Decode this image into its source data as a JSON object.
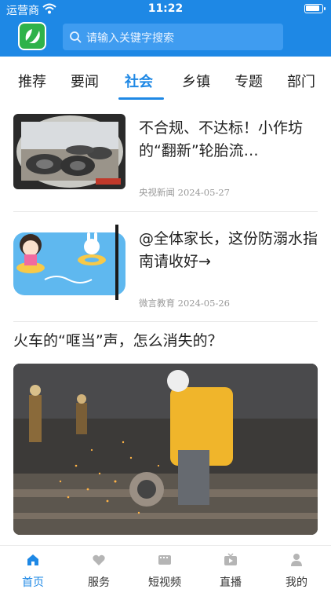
{
  "status_bar": {
    "carrier": "运营商",
    "time": "11:22"
  },
  "header": {
    "search_placeholder": "请输入关键字搜索"
  },
  "tabs": [
    {
      "label": "推荐",
      "active": false
    },
    {
      "label": "要闻",
      "active": false
    },
    {
      "label": "社会",
      "active": true
    },
    {
      "label": "乡镇",
      "active": false
    },
    {
      "label": "专题",
      "active": false
    },
    {
      "label": "部门",
      "active": false
    }
  ],
  "articles": [
    {
      "title": "不合规、不达标！小作坊的“翻新”轮胎流…",
      "source": "央视新闻",
      "date": "2024-05-27"
    },
    {
      "title": "@全体家长，这份防溺水指南请收好→",
      "source": "微言教育",
      "date": "2024-05-26"
    }
  ],
  "featured": {
    "title": "火车的“哐当”声，怎么消失的？"
  },
  "bottom_nav": [
    {
      "label": "首页",
      "icon": "home-icon",
      "active": true
    },
    {
      "label": "服务",
      "icon": "heart-icon",
      "active": false
    },
    {
      "label": "短视频",
      "icon": "film-icon",
      "active": false
    },
    {
      "label": "直播",
      "icon": "tv-icon",
      "active": false
    },
    {
      "label": "我的",
      "icon": "person-icon",
      "active": false
    }
  ],
  "colors": {
    "brand": "#1e88e5",
    "logo_green": "#2fb24a"
  }
}
